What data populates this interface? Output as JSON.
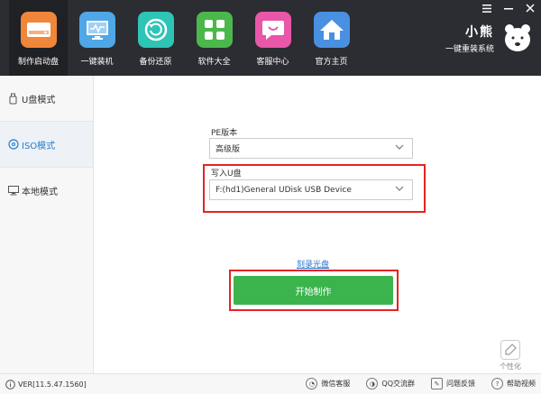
{
  "nav": {
    "items": [
      {
        "label": "制作启动盘",
        "icon": "usb-drive-icon",
        "color": "#f0863a"
      },
      {
        "label": "一键装机",
        "icon": "monitor-icon",
        "color": "#4fa7e8"
      },
      {
        "label": "备份还原",
        "icon": "restore-icon",
        "color": "#2ec4b6"
      },
      {
        "label": "软件大全",
        "icon": "apps-grid-icon",
        "color": "#4cb84c"
      },
      {
        "label": "客服中心",
        "icon": "chat-icon",
        "color": "#e857a8"
      },
      {
        "label": "官方主页",
        "icon": "home-icon",
        "color": "#4a90e2"
      }
    ]
  },
  "brand": {
    "title": "小熊",
    "subtitle": "一键重装系统"
  },
  "sidebar": {
    "items": [
      {
        "label": "U盘模式",
        "icon": "usb-icon"
      },
      {
        "label": "ISO模式",
        "icon": "disc-icon"
      },
      {
        "label": "本地模式",
        "icon": "computer-icon"
      }
    ]
  },
  "form": {
    "pe_label": "PE版本",
    "pe_value": "高级版",
    "usb_label": "写入U盘",
    "usb_value": "F:(hd1)General UDisk USB Device",
    "burn_link": "刻录光盘",
    "start_button": "开始制作"
  },
  "personalize": "个性化",
  "footer": {
    "version": "VER[11.5.47.1560]",
    "links": [
      {
        "label": "微信客服",
        "icon": "wechat-icon"
      },
      {
        "label": "QQ交流群",
        "icon": "qq-icon"
      },
      {
        "label": "问题反馈",
        "icon": "feedback-icon"
      },
      {
        "label": "帮助视频",
        "icon": "help-video-icon"
      }
    ]
  },
  "colors": {
    "accent": "#3cb44e",
    "highlight": "#e52323",
    "header": "#2b2d33",
    "link": "#2a73c9"
  }
}
